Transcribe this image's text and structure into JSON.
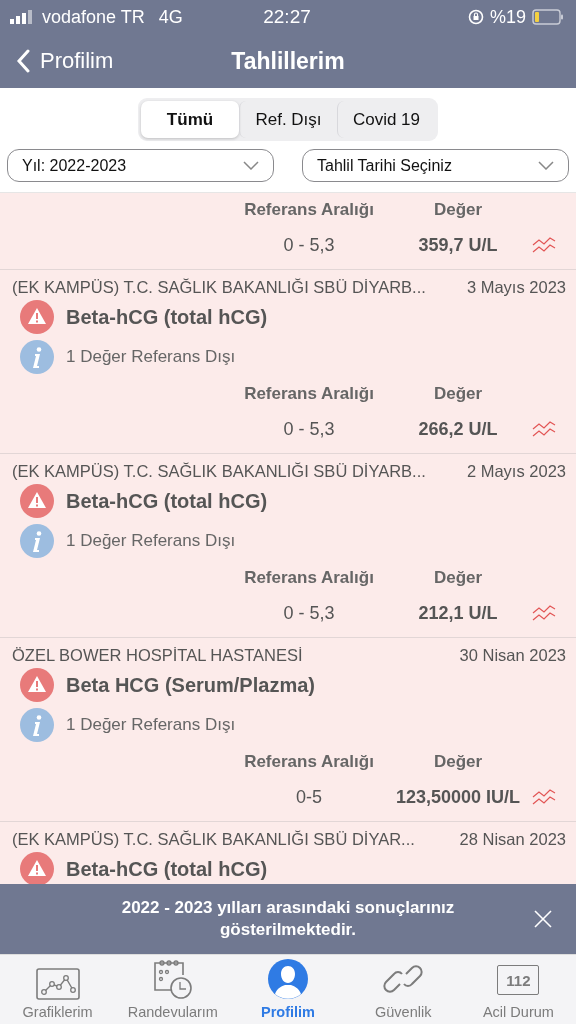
{
  "status_bar": {
    "carrier": "vodafone TR",
    "network": "4G",
    "time": "22:27",
    "battery": "%19"
  },
  "nav": {
    "back": "Profilim",
    "title": "Tahlillerim"
  },
  "segments": [
    {
      "label": "Tümü",
      "selected": true
    },
    {
      "label": "Ref. Dışı",
      "selected": false
    },
    {
      "label": "Covid 19",
      "selected": false
    }
  ],
  "filters": [
    {
      "value": "Yıl: 2022-2023"
    },
    {
      "value": "Tahlil Tarihi Seçiniz"
    }
  ],
  "results": [
    {
      "ref_label": "Referans Aralığı",
      "value_label": "Değer",
      "range": "0 - 5,3",
      "value": "359,7 U/L"
    },
    {
      "lab": "(EK KAMPÜS) T.C. SAĞLIK BAKANLIĞI SBÜ DİYARB...",
      "date": "3 Mayıs 2023",
      "test": "Beta-hCG (total hCG)",
      "note": "1 Değer Referans Dışı",
      "ref_label": "Referans Aralığı",
      "value_label": "Değer",
      "range": "0 - 5,3",
      "value": "266,2 U/L"
    },
    {
      "lab": "(EK KAMPÜS) T.C. SAĞLIK BAKANLIĞI SBÜ DİYARB...",
      "date": "2 Mayıs 2023",
      "test": "Beta-hCG (total hCG)",
      "note": "1 Değer Referans Dışı",
      "ref_label": "Referans Aralığı",
      "value_label": "Değer",
      "range": "0 - 5,3",
      "value": "212,1 U/L"
    },
    {
      "lab": "ÖZEL BOWER HOSPİTAL HASTANESİ",
      "date": "30 Nisan 2023",
      "test": "Beta HCG (Serum/Plazma)",
      "note": "1 Değer Referans Dışı",
      "ref_label": "Referans Aralığı",
      "value_label": "Değer",
      "range": "0-5",
      "value": "123,50000 IU/L"
    },
    {
      "lab": "(EK KAMPÜS) T.C. SAĞLIK BAKANLIĞI SBÜ DİYAR...",
      "date": "28 Nisan 2023",
      "test": "Beta-hCG (total hCG)"
    }
  ],
  "toast": {
    "message": "2022 - 2023 yılları arasındaki sonuçlarınız gösterilmektedir."
  },
  "tab_bar": [
    {
      "label": "Grafiklerim",
      "kind": "chart",
      "selected": false
    },
    {
      "label": "Randevularım",
      "kind": "calendar",
      "selected": false
    },
    {
      "label": "Profilim",
      "kind": "person",
      "selected": true
    },
    {
      "label": "Güvenlik",
      "kind": "link",
      "selected": false
    },
    {
      "label": "Acil Durum",
      "kind": "emergency",
      "selected": false,
      "badge": "112"
    }
  ]
}
